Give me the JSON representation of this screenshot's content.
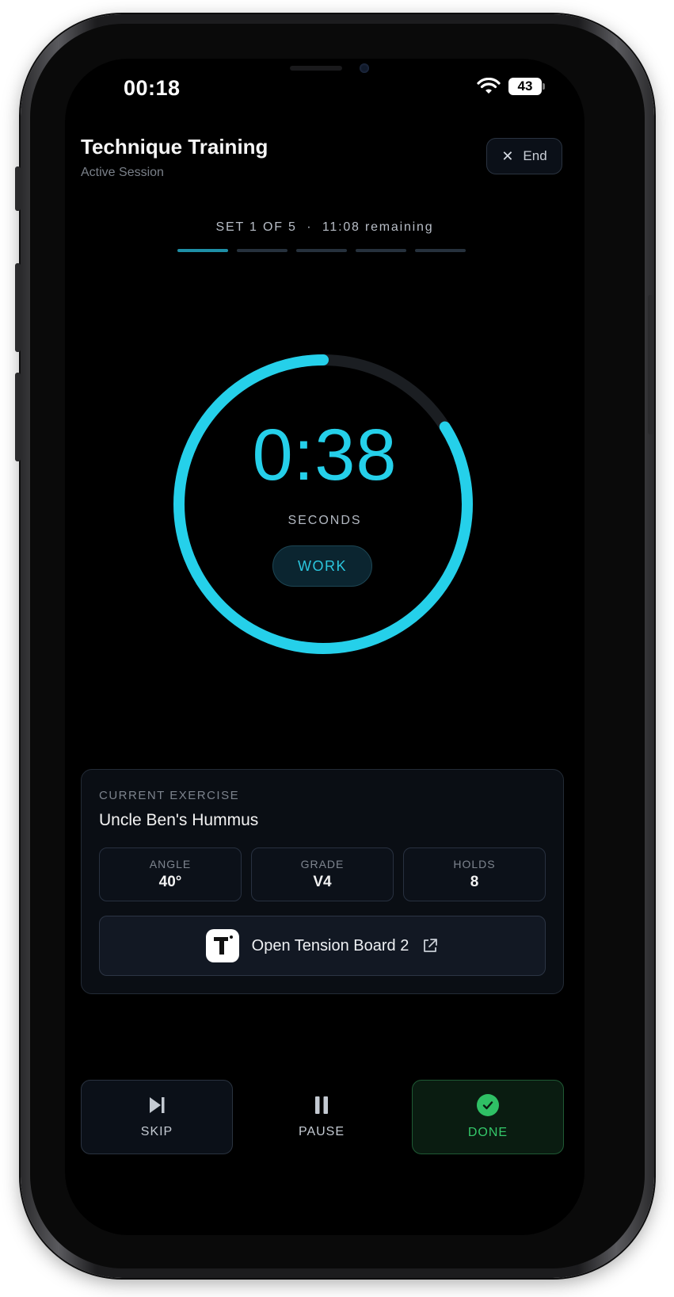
{
  "status_bar": {
    "time": "00:18",
    "battery": "43"
  },
  "header": {
    "title": "Technique Training",
    "subtitle": "Active Session",
    "end_label": "End"
  },
  "progress": {
    "set_label": "SET 1 OF 5",
    "separator": "·",
    "remaining": "11:08 remaining",
    "total_sets": 5,
    "current_set": 1
  },
  "timer": {
    "value": "0:38",
    "unit_label": "SECONDS",
    "phase": "WORK",
    "fraction_remaining": 0.84,
    "accent": "#25d0ea"
  },
  "exercise": {
    "section_label": "CURRENT EXERCISE",
    "name": "Uncle Ben's Hummus",
    "stats": [
      {
        "label": "ANGLE",
        "value": "40°"
      },
      {
        "label": "GRADE",
        "value": "V4"
      },
      {
        "label": "HOLDS",
        "value": "8"
      }
    ],
    "open_button_label": "Open Tension Board 2"
  },
  "controls": {
    "skip_label": "SKIP",
    "pause_label": "PAUSE",
    "done_label": "DONE",
    "done_color": "#34c86a"
  }
}
